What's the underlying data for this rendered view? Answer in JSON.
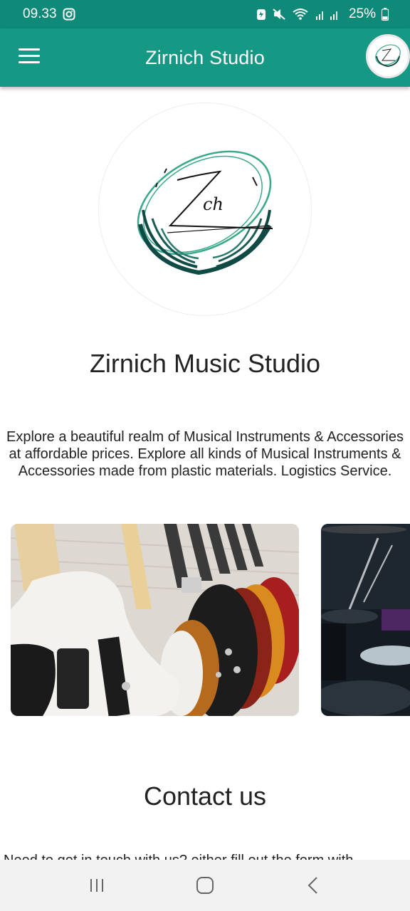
{
  "status": {
    "time": "09.33",
    "battery": "25%"
  },
  "app_bar": {
    "title": "Zirnich Studio"
  },
  "logo": {
    "text_main": "Z",
    "text_sub": "ch"
  },
  "main": {
    "studio_name": "Zirnich Music Studio",
    "description": "Explore a beautiful realm of Musical Instruments & Accessories at affordable prices. Explore all kinds of Musical Instruments & Accessories made from plastic materials. Logistics Service.",
    "contact_title": "Contact us",
    "contact_text": "Need to get in touch with us? either fill out the form with"
  },
  "colors": {
    "primary": "#159985",
    "status": "#108a78",
    "logo_green": "#3aa88a",
    "logo_dark": "#0f4a45"
  }
}
